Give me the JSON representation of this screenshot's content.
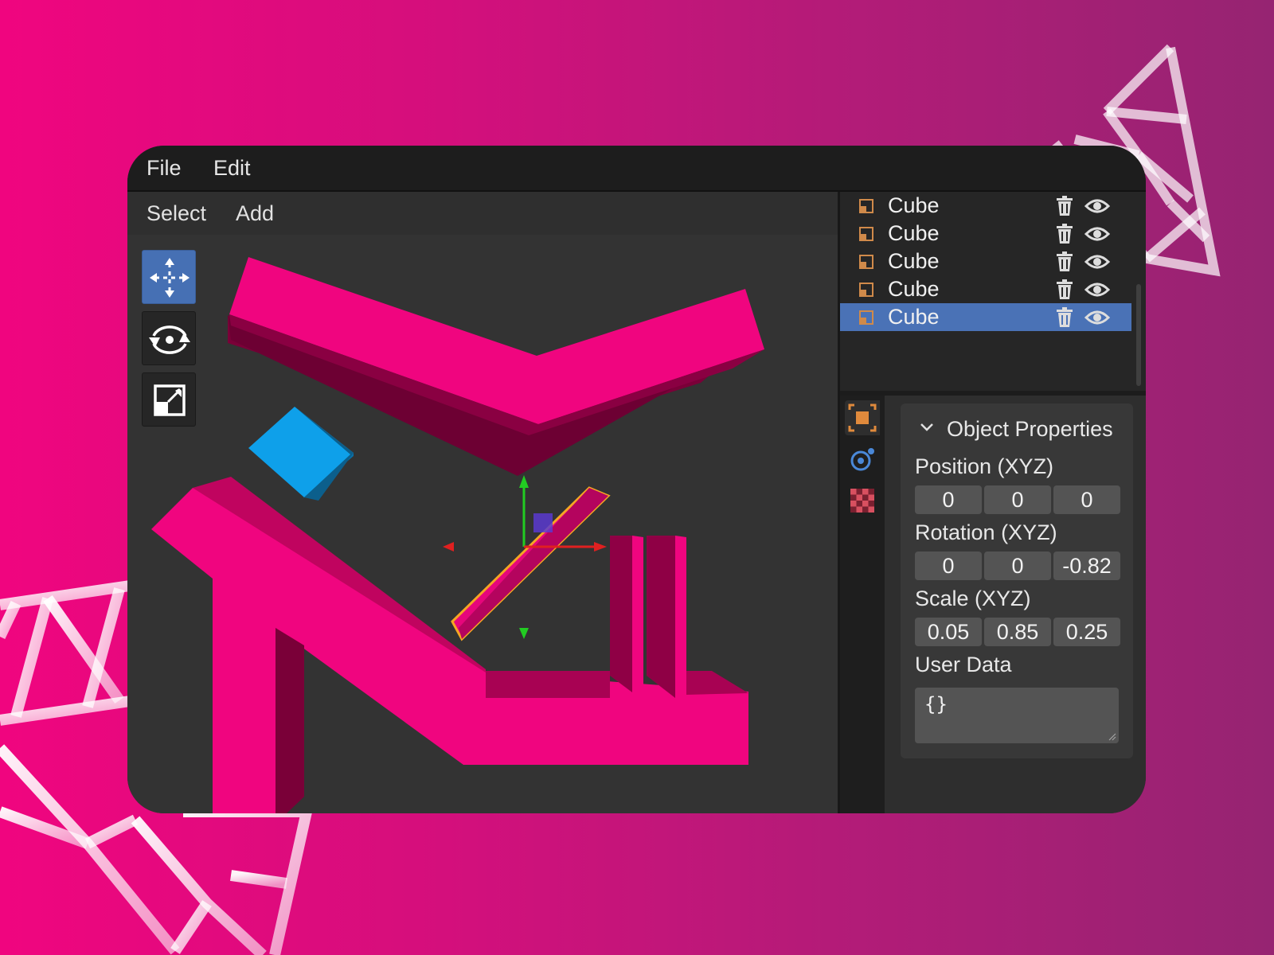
{
  "menubar": {
    "file": "File",
    "edit": "Edit"
  },
  "viewport": {
    "menu": {
      "select": "Select",
      "add": "Add"
    },
    "tools": [
      {
        "icon": "move-icon",
        "active": true
      },
      {
        "icon": "rotate-icon",
        "active": false
      },
      {
        "icon": "scale-icon",
        "active": false
      }
    ]
  },
  "outliner": {
    "items": [
      {
        "label": "Cube",
        "selected": false
      },
      {
        "label": "Cube",
        "selected": false
      },
      {
        "label": "Cube",
        "selected": false
      },
      {
        "label": "Cube",
        "selected": false
      },
      {
        "label": "Cube",
        "selected": true
      }
    ]
  },
  "properties": {
    "tabs": [
      "object-tab-icon",
      "physics-tab-icon",
      "material-tab-icon"
    ],
    "title": "Object Properties",
    "position": {
      "label": "Position (XYZ)",
      "x": "0",
      "y": "0",
      "z": "0"
    },
    "rotation": {
      "label": "Rotation (XYZ)",
      "x": "0",
      "y": "0",
      "z": "-0.82"
    },
    "scale": {
      "label": "Scale (XYZ)",
      "x": "0.05",
      "y": "0.85",
      "z": "0.25"
    },
    "user_data": {
      "label": "User Data",
      "value": "{}"
    }
  },
  "colors": {
    "accent": "#4a72b6",
    "object_pink": "#f0057f",
    "object_blue": "#0ea0ea"
  }
}
